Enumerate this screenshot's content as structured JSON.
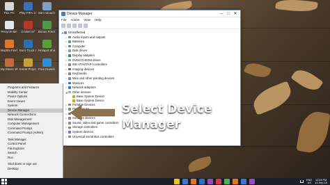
{
  "desktop_icons": [
    {
      "label": "This PC",
      "color": "#d8d8d8"
    },
    {
      "label": "Play FIFA 14 (PC) 2013",
      "color": "#3c6fb5"
    },
    {
      "label": "Sam Cloud Computing",
      "color": "#7aa0c8"
    },
    {
      "label": "Recycle Bin",
      "color": "#dfe8ef"
    },
    {
      "label": "Cricket 07",
      "color": "#b23a2c"
    },
    {
      "label": "Bonus Freelancer",
      "color": "#4a9a4a"
    },
    {
      "label": "Mozilla Firefox",
      "color": "#e0762a"
    },
    {
      "label": "Euro Truck Simulator 2",
      "color": "#2d6fb3"
    },
    {
      "label": "Hotspot Shield",
      "color": "#54a33a"
    },
    {
      "label": "My Movie Shows",
      "color": "#c06a3a"
    },
    {
      "label": "Event Project",
      "color": "#c2a040"
    },
    {
      "label": "Free Download",
      "color": "#2d8fd8"
    }
  ],
  "window": {
    "title": "Device Manager",
    "menu": [
      "File",
      "Action",
      "View",
      "Help"
    ],
    "tree": [
      {
        "label": "Unmaffected",
        "level": 0,
        "toggle": "◢",
        "color": "#6a8fc0"
      },
      {
        "label": "Audio inputs and outputs",
        "level": 1,
        "toggle": "▷",
        "color": "#8a8a8a"
      },
      {
        "label": "Batteries",
        "level": 1,
        "toggle": "▷",
        "color": "#4caf50"
      },
      {
        "label": "Computer",
        "level": 1,
        "toggle": "▷",
        "color": "#5a86c2"
      },
      {
        "label": "Disk drives",
        "level": 1,
        "toggle": "▷",
        "color": "#9a9a9a"
      },
      {
        "label": "Display adapters",
        "level": 1,
        "toggle": "▷",
        "color": "#3c78c8"
      },
      {
        "label": "DVD/CD-ROM drives",
        "level": 1,
        "toggle": "▷",
        "color": "#a0a0a0"
      },
      {
        "label": "IDE ATA/ATAPI controllers",
        "level": 1,
        "toggle": "▷",
        "color": "#8a8a8a"
      },
      {
        "label": "Imaging devices",
        "level": 1,
        "toggle": "▷",
        "color": "#6b6b6b"
      },
      {
        "label": "Keyboards",
        "level": 1,
        "toggle": "▷",
        "color": "#8a8a8a"
      },
      {
        "label": "Mice and other pointing devices",
        "level": 1,
        "toggle": "▷",
        "color": "#8a8a8a"
      },
      {
        "label": "Monitors",
        "level": 1,
        "toggle": "▷",
        "color": "#3c78c8"
      },
      {
        "label": "Network adapters",
        "level": 1,
        "toggle": "▷",
        "color": "#3c78c8"
      },
      {
        "label": "Other devices",
        "level": 1,
        "toggle": "◢",
        "color": "#b0b0b0"
      },
      {
        "label": "Base System Device",
        "level": 2,
        "toggle": "",
        "color": "#d4a020"
      },
      {
        "label": "Base System Device",
        "level": 2,
        "toggle": "",
        "color": "#d4a020"
      },
      {
        "label": "Portable Devices",
        "level": 1,
        "toggle": "▷",
        "color": "#8a8a8a"
      },
      {
        "label": "Print queues",
        "level": 1,
        "toggle": "▷",
        "color": "#8a8a8a"
      },
      {
        "label": "Processors",
        "level": 1,
        "toggle": "▷",
        "color": "#7a7a7a"
      },
      {
        "label": "Software devices",
        "level": 1,
        "toggle": "▷",
        "color": "#8a8a8a"
      },
      {
        "label": "Sound, video and game controllers",
        "level": 1,
        "toggle": "▷",
        "color": "#8a8a8a"
      },
      {
        "label": "Storage controllers",
        "level": 1,
        "toggle": "▷",
        "color": "#8a8a8a"
      },
      {
        "label": "System devices",
        "level": 1,
        "toggle": "▷",
        "color": "#5a86c2"
      },
      {
        "label": "Universal Serial Bus controllers",
        "level": 1,
        "toggle": "▷",
        "color": "#8a8a8a"
      }
    ]
  },
  "winx_menu": [
    {
      "label": "Programs and Features"
    },
    {
      "label": "Mobility Center"
    },
    {
      "label": "Power Options"
    },
    {
      "label": "Event Viewer"
    },
    {
      "label": "System"
    },
    {
      "label": "Device Manager",
      "selected": true
    },
    {
      "label": "Network Connections"
    },
    {
      "label": "Disk Management"
    },
    {
      "label": "Computer Management"
    },
    {
      "label": "Command Prompt"
    },
    {
      "label": "Command Prompt (Admin)"
    },
    {
      "sep": true
    },
    {
      "label": "Task Manager"
    },
    {
      "label": "Control Panel"
    },
    {
      "label": "File Explorer"
    },
    {
      "label": "Search"
    },
    {
      "label": "Run"
    },
    {
      "sep": true
    },
    {
      "label": "Shut down or sign out"
    },
    {
      "label": "Desktop"
    }
  ],
  "callout": {
    "line1": "Select Device",
    "line2": "Manager"
  },
  "taskbar": {
    "pinned_colors": [
      "#f0c020",
      "#3c78c8",
      "#e0762a",
      "#2a6fc9",
      "#9a4ac0",
      "#d23c3c",
      "#4caf50",
      "#e0762a",
      "#3c78c8",
      "#9a4ac0"
    ],
    "lang": "ENG",
    "lang2": "US",
    "time": "12:04 PM",
    "date": "14-Sep-15"
  }
}
